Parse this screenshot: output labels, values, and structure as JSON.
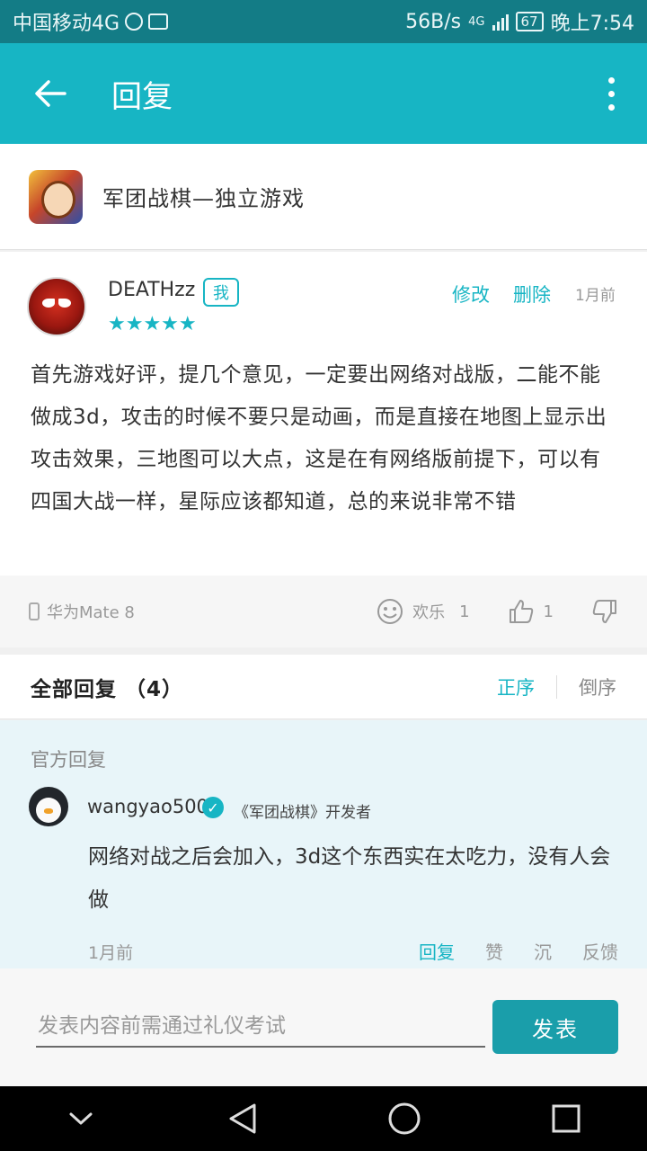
{
  "status_bar": {
    "carrier": "中国移动4G",
    "speed": "56B/s",
    "network": "4G",
    "battery": "67",
    "time": "晚上7:54"
  },
  "app_bar": {
    "title": "回复"
  },
  "game": {
    "name": "军团战棋—独立游戏"
  },
  "review": {
    "username": "DEATHzz",
    "me_badge": "我",
    "rating": 5,
    "stars": "★★★★★",
    "edit_label": "修改",
    "delete_label": "删除",
    "time": "1月前",
    "body": "首先游戏好评，提几个意见，一定要出网络对战版，二能不能做成3d，攻击的时候不要只是动画，而是直接在地图上显示出攻击效果，三地图可以大点，这是在有网络版前提下，可以有四国大战一样，星际应该都知道，总的来说非常不错",
    "device": "华为Mate  8",
    "funny_label": "欢乐",
    "funny_count": "1",
    "like_count": "1"
  },
  "replies": {
    "title": "全部回复 （4）",
    "sort_asc": "正序",
    "sort_desc": "倒序"
  },
  "official_reply": {
    "label": "官方回复",
    "username": "wangyao500",
    "verified_mark": "✓",
    "tag": "《军团战棋》开发者",
    "body": "网络对战之后会加入，3d这个东西实在太吃力，没有人会做",
    "time": "1月前",
    "actions": [
      "回复",
      "赞",
      "沉",
      "反馈"
    ]
  },
  "composer": {
    "placeholder": "发表内容前需通过礼仪考试",
    "submit_label": "发表"
  },
  "colors": {
    "accent": "#17b5c4",
    "status_bar": "#137c86",
    "official_bg": "#e8f5f9"
  }
}
